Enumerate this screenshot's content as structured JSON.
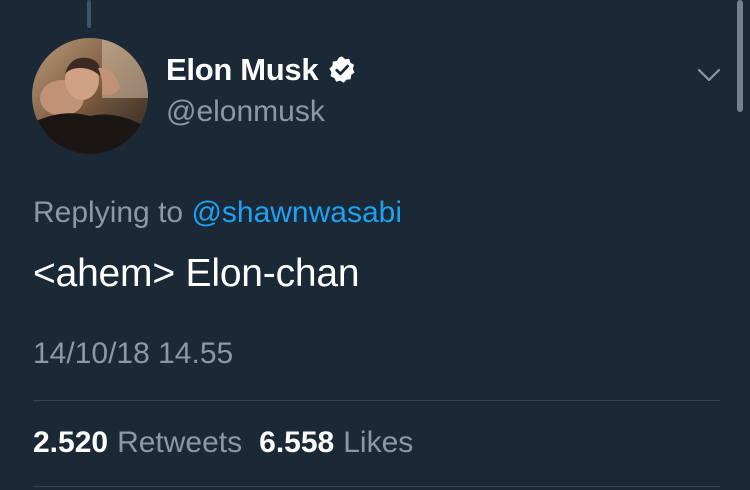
{
  "tweet": {
    "author": {
      "display_name": "Elon Musk",
      "handle": "@elonmusk",
      "verified": true,
      "verified_icon": "verified-badge-icon"
    },
    "menu_icon": "chevron-down-icon",
    "replying_to_prefix": "Replying to",
    "replying_to_handle": "@shawnwasabi",
    "text": "<ahem> Elon-chan",
    "timestamp": "14/10/18 14.55",
    "stats": {
      "retweets_count": "2.520",
      "retweets_label": "Retweets",
      "likes_count": "6.558",
      "likes_label": "Likes"
    }
  },
  "colors": {
    "background": "#1b2836",
    "primary_text": "#ffffff",
    "secondary_text": "#8b98a5",
    "link": "#1da1f2",
    "divider": "#38444d"
  }
}
